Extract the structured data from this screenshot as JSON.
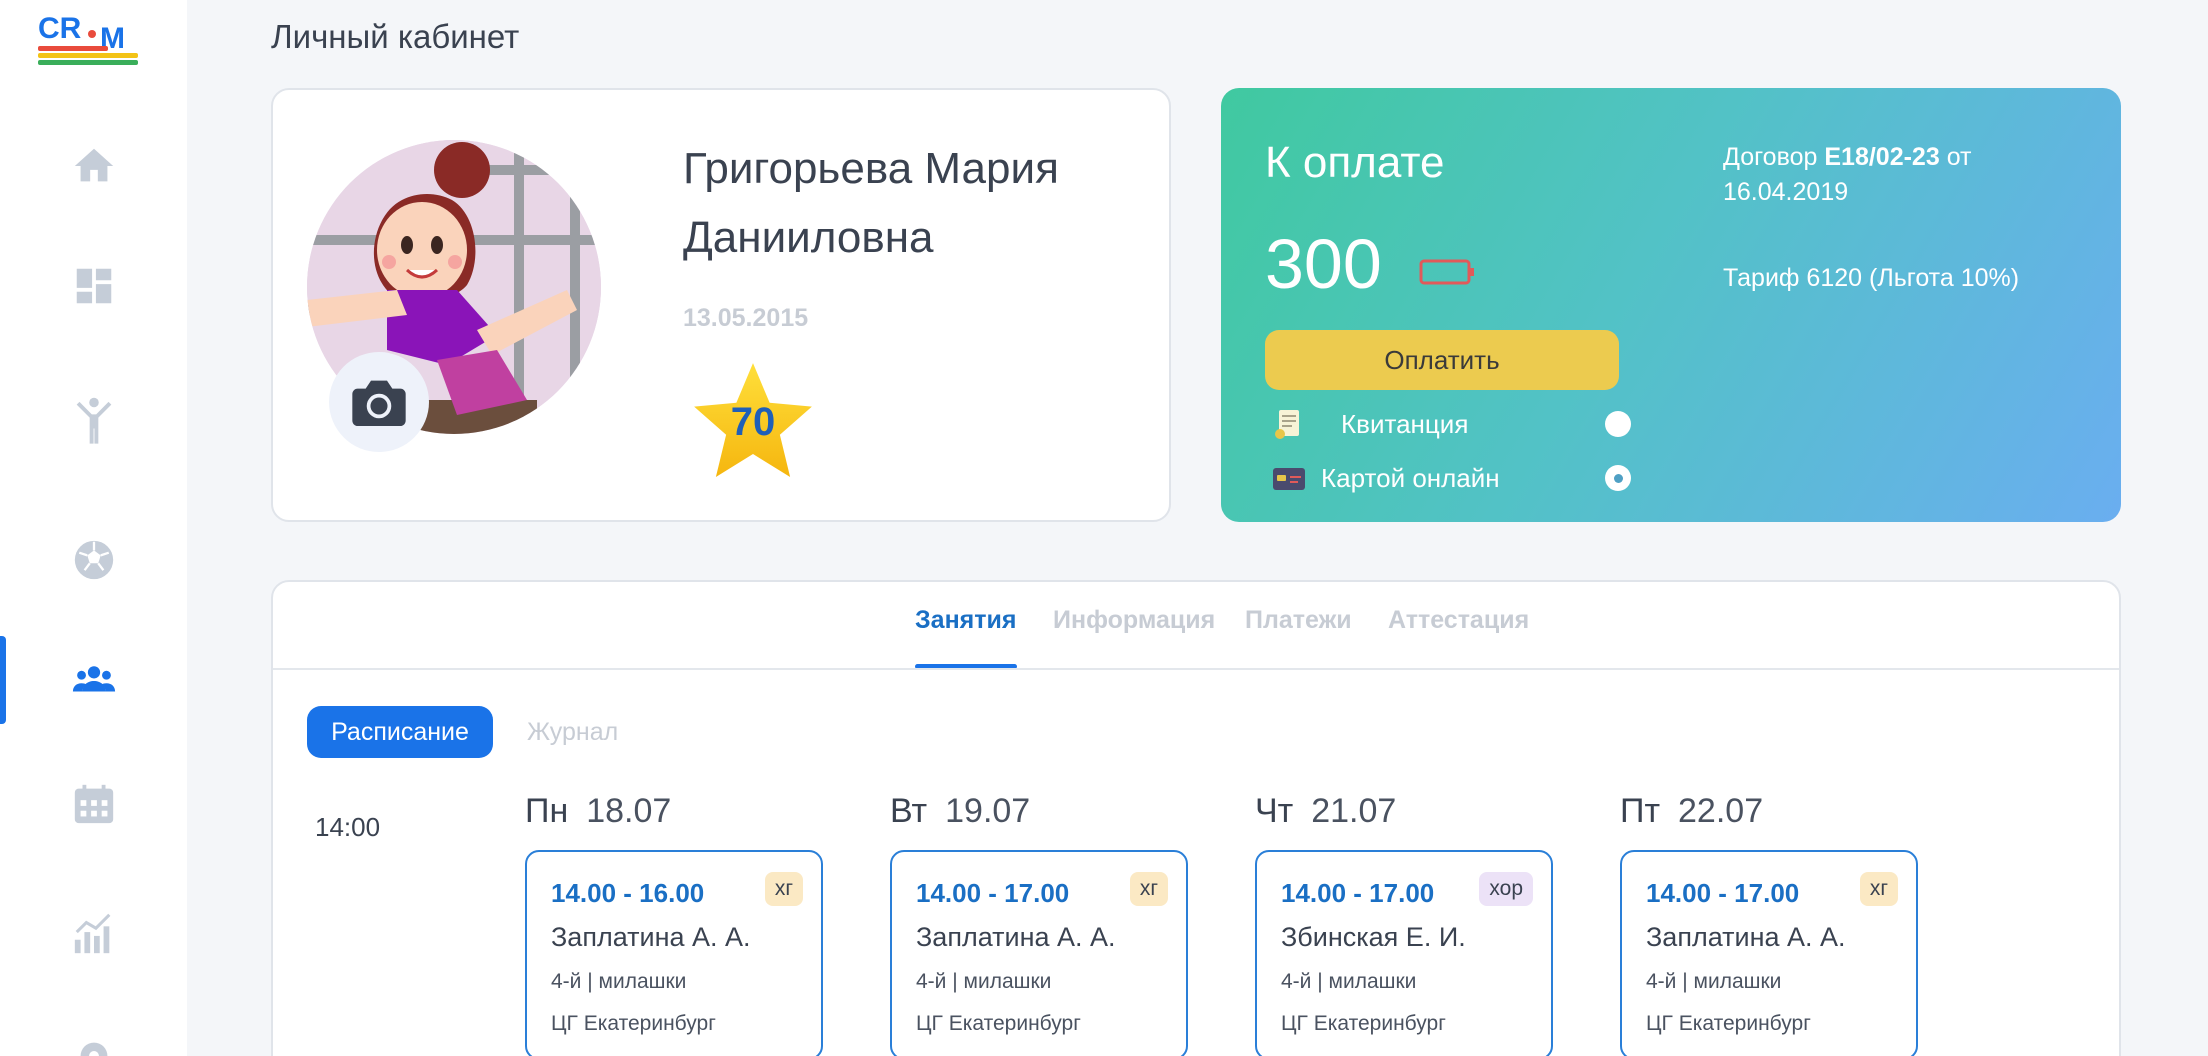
{
  "app": {
    "logo_text": "CRM",
    "page_title": "Личный кабинет"
  },
  "sidebar": {
    "items": [
      {
        "icon": "home-icon"
      },
      {
        "icon": "dashboard-icon"
      },
      {
        "icon": "athlete-icon"
      },
      {
        "icon": "ball-icon"
      },
      {
        "icon": "group-icon",
        "active": true
      },
      {
        "icon": "calendar-icon"
      },
      {
        "icon": "chart-icon"
      },
      {
        "icon": "gear-icon"
      }
    ],
    "accent_color": "#1a73e8"
  },
  "profile": {
    "name": "Григорьева Мария Данииловна",
    "birth_date": "13.05.2015",
    "rating": "70"
  },
  "payment": {
    "title": "К оплате",
    "amount": "300",
    "pay_button": "Оплатить",
    "options": [
      {
        "label": "Квитанция",
        "selected": false
      },
      {
        "label": "Картой онлайн",
        "selected": true
      }
    ],
    "contract_prefix": "Договор",
    "contract_number": "Е18/02-23",
    "contract_from": "от",
    "contract_date": "16.04.2019",
    "tariff": "Тариф 6120 (Льгота 10%)"
  },
  "tabs": [
    {
      "label": "Занятия",
      "active": true
    },
    {
      "label": "Информация"
    },
    {
      "label": "Платежи"
    },
    {
      "label": "Аттестация"
    }
  ],
  "subtabs": {
    "active": "Расписание",
    "inactive": "Журнал"
  },
  "schedule": {
    "time_label": "14:00",
    "days": [
      {
        "weekday": "Пн",
        "date": "18.07",
        "time": "14.00 - 16.00",
        "tag": "хг",
        "teacher": "Заплатина А. А.",
        "group": "4-й | милашки",
        "place": "ЦГ Екатеринбург"
      },
      {
        "weekday": "Вт",
        "date": "19.07",
        "time": "14.00 - 17.00",
        "tag": "хг",
        "teacher": "Заплатина А. А.",
        "group": "4-й | милашки",
        "place": "ЦГ Екатеринбург"
      },
      {
        "weekday": "Чт",
        "date": "21.07",
        "time": "14.00 - 17.00",
        "tag": "хор",
        "teacher": "Збинская Е. И.",
        "group": "4-й | милашки",
        "place": "ЦГ Екатеринбург"
      },
      {
        "weekday": "Пт",
        "date": "22.07",
        "time": "14.00 - 17.00",
        "tag": "хг",
        "teacher": "Заплатина А. А.",
        "group": "4-й | милашки",
        "place": "ЦГ Екатеринбург"
      }
    ]
  }
}
